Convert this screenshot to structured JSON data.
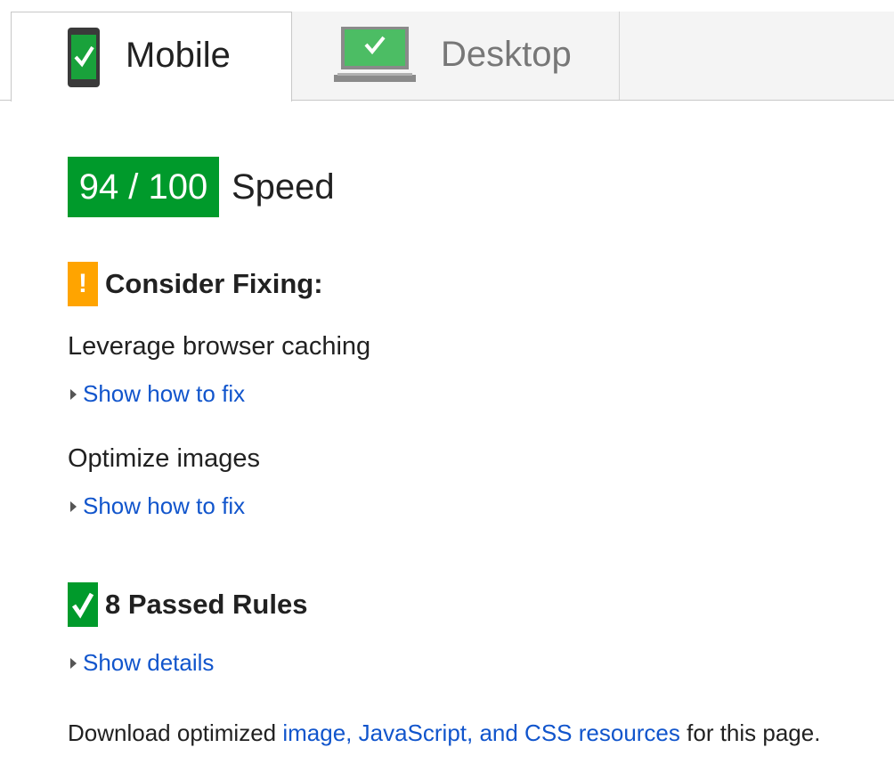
{
  "tabs": {
    "mobile": {
      "label": "Mobile",
      "icon": "mobile-phone-check-icon"
    },
    "desktop": {
      "label": "Desktop",
      "icon": "laptop-check-icon"
    }
  },
  "score": {
    "value": "94 / 100",
    "label": "Speed",
    "color": "#009a2b"
  },
  "consider_fixing": {
    "heading": "Consider Fixing:",
    "icon": "warning-icon",
    "icon_glyph": "!",
    "color": "#ffa400",
    "rules": [
      {
        "title": "Leverage browser caching",
        "link": "Show how to fix"
      },
      {
        "title": "Optimize images",
        "link": "Show how to fix"
      }
    ]
  },
  "passed": {
    "heading": "8 Passed Rules",
    "icon": "check-icon",
    "link": "Show details"
  },
  "footer": {
    "prefix": "Download optimized ",
    "link": "image, JavaScript, and CSS resources",
    "suffix": " for this page."
  },
  "colors": {
    "link": "#1155cc",
    "pass_green": "#009a2b",
    "warn_orange": "#ffa400"
  }
}
